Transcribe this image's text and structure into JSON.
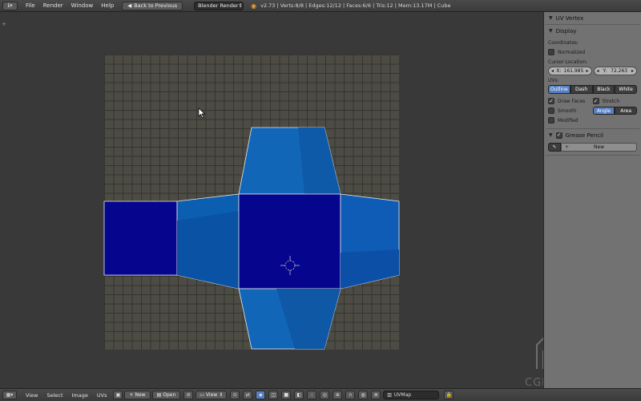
{
  "top_bar": {
    "editor_icon": "info-icon",
    "menus": [
      "File",
      "Render",
      "Window",
      "Help"
    ],
    "back_button": "Back to Previous",
    "render_engine": "Blender Render",
    "stats": "v2.73 | Verts:8/8 | Edges:12/12 | Faces:6/6 | Tris:12 | Mem:13.17M | Cube"
  },
  "side_panel": {
    "uv_vertex_header": "UV Vertex",
    "display_header": "Display",
    "coordinates_label": "Coordinates:",
    "normalized_label": "Normalized",
    "normalized_checked": false,
    "cursor_location_label": "Cursor Location:",
    "cursor_x_label": "X:",
    "cursor_x_value": "161.985",
    "cursor_y_label": "Y:",
    "cursor_y_value": "72.263",
    "uvs_label": "UVs:",
    "uv_styles": [
      "Outline",
      "Dash",
      "Black",
      "White"
    ],
    "uv_style_active": "Outline",
    "draw_faces_label": "Draw Faces",
    "draw_faces_checked": true,
    "stretch_label": "Stretch",
    "stretch_checked": true,
    "smooth_label": "Smooth",
    "smooth_checked": false,
    "modified_label": "Modified",
    "modified_checked": false,
    "stretch_modes": [
      "Angle",
      "Area"
    ],
    "stretch_mode_active": "Angle",
    "grease_pencil_header": "Grease Pencil",
    "grease_pencil_checked": true,
    "new_button": "New"
  },
  "bottom_bar": {
    "menus": [
      "View",
      "Select",
      "Image",
      "UVs"
    ],
    "new_button": "New",
    "open_button": "Open",
    "view_mode": "View",
    "uv_map": "UVMap"
  },
  "watermark": {
    "text": "CGMASTERS"
  },
  "colors": {
    "uv_face_stretched": "#0a63b0",
    "uv_face_dark": "#0a0a8e",
    "grid_bg": "#4c4b44",
    "accent_blue": "#5680c2"
  }
}
